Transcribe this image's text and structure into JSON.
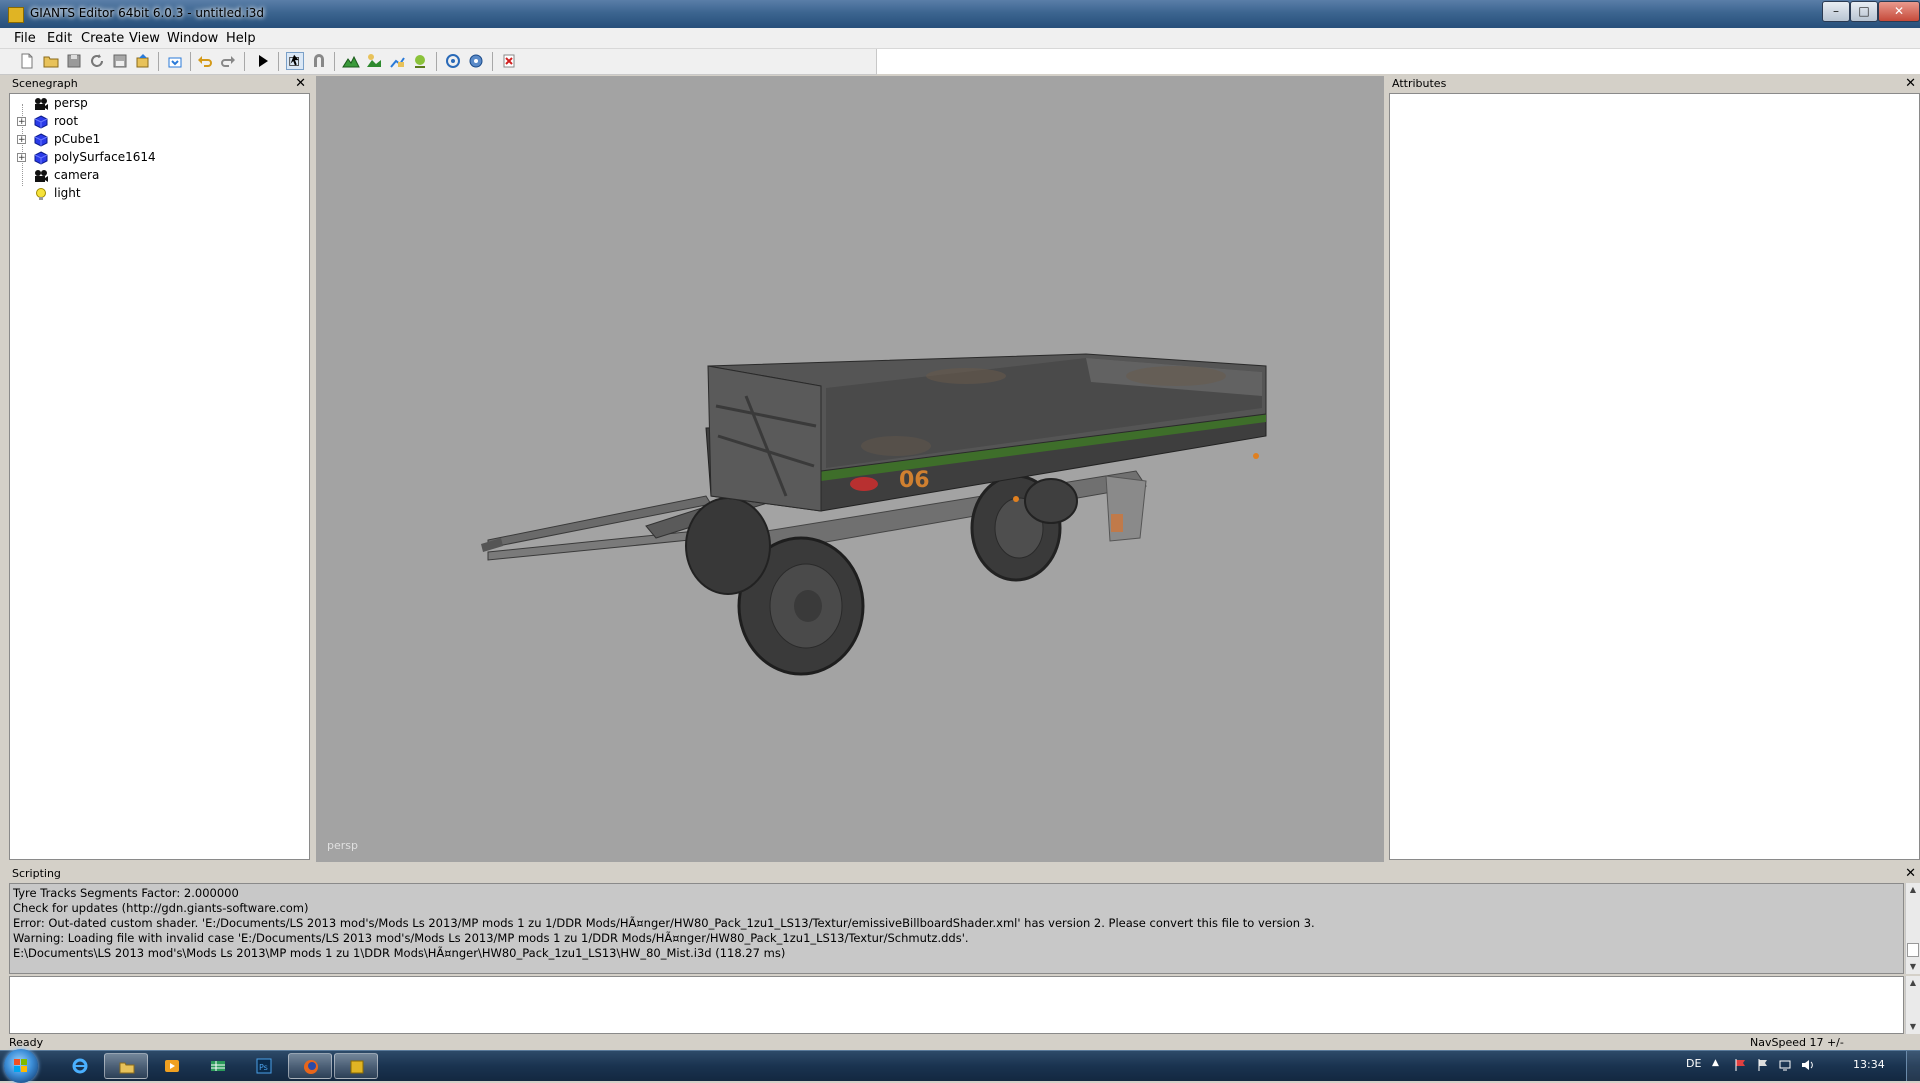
{
  "window": {
    "title": "GIANTS Editor 64bit 6.0.3 - untitled.i3d",
    "minimize_label": "–",
    "maximize_label": "□",
    "close_label": "✕"
  },
  "menu": {
    "items": [
      "File",
      "Edit",
      "Create",
      "View",
      "Window",
      "Help"
    ]
  },
  "toolbar": {
    "icons": [
      "new-file-icon",
      "open-file-icon",
      "save-gray-icon",
      "refresh-icon",
      "save-icon",
      "export-icon",
      "import-icon",
      "undo-icon",
      "redo-icon",
      "play-icon",
      "select-tool-icon",
      "magnet-icon",
      "add-terrain-icon",
      "add-shape-icon",
      "add-transform-icon",
      "add-light-icon",
      "rotate-icon",
      "settings-icon",
      "delete-icon"
    ]
  },
  "scenegraph": {
    "title": "Scenegraph",
    "close_label": "✕",
    "nodes": [
      {
        "label": "persp",
        "icon": "camera-icon",
        "expandable": false
      },
      {
        "label": "root",
        "icon": "cube-icon",
        "expandable": true
      },
      {
        "label": "pCube1",
        "icon": "cube-icon",
        "expandable": true
      },
      {
        "label": "polySurface1614",
        "icon": "cube-icon",
        "expandable": true
      },
      {
        "label": "camera",
        "icon": "camera-icon",
        "expandable": false
      },
      {
        "label": "light",
        "icon": "light-bulb-icon",
        "expandable": false
      }
    ]
  },
  "viewport": {
    "camera_label": "persp",
    "background_color": "#a3a3a3",
    "trailer_number": "06"
  },
  "attributes": {
    "title": "Attributes",
    "close_label": "✕"
  },
  "scripting": {
    "title": "Scripting",
    "close_label": "✕",
    "log": [
      "  Tyre Tracks Segments Factor: 2.000000",
      "Check for updates (http://gdn.giants-software.com)",
      "Error: Out-dated custom shader. 'E:/Documents/LS 2013 mod's/Mods Ls 2013/MP mods 1 zu 1/DDR Mods/HÃ¤nger/HW80_Pack_1zu1_LS13/Textur/emissiveBillboardShader.xml' has version 2. Please convert this file to version 3.",
      "Warning: Loading file with invalid case 'E:/Documents/LS 2013 mod's/Mods Ls 2013/MP mods 1 zu 1/DDR Mods/HÃ¤nger/HW80_Pack_1zu1_LS13/Textur/Schmutz.dds'.",
      "E:\\Documents\\LS 2013 mod's\\Mods Ls 2013\\MP mods 1 zu 1\\DDR Mods\\HÃ¤nger\\HW80_Pack_1zu1_LS13\\HW_80_Mist.i3d (118.27 ms)"
    ]
  },
  "statusbar": {
    "left_text": "Ready",
    "right_text": "NavSpeed 17 +/-"
  },
  "taskbar": {
    "apps": [
      "internet-explorer-icon",
      "file-explorer-icon",
      "media-player-icon",
      "spreadsheet-icon",
      "photoshop-icon",
      "firefox-icon",
      "giants-editor-icon"
    ],
    "language": "DE",
    "clock": "13:34"
  }
}
